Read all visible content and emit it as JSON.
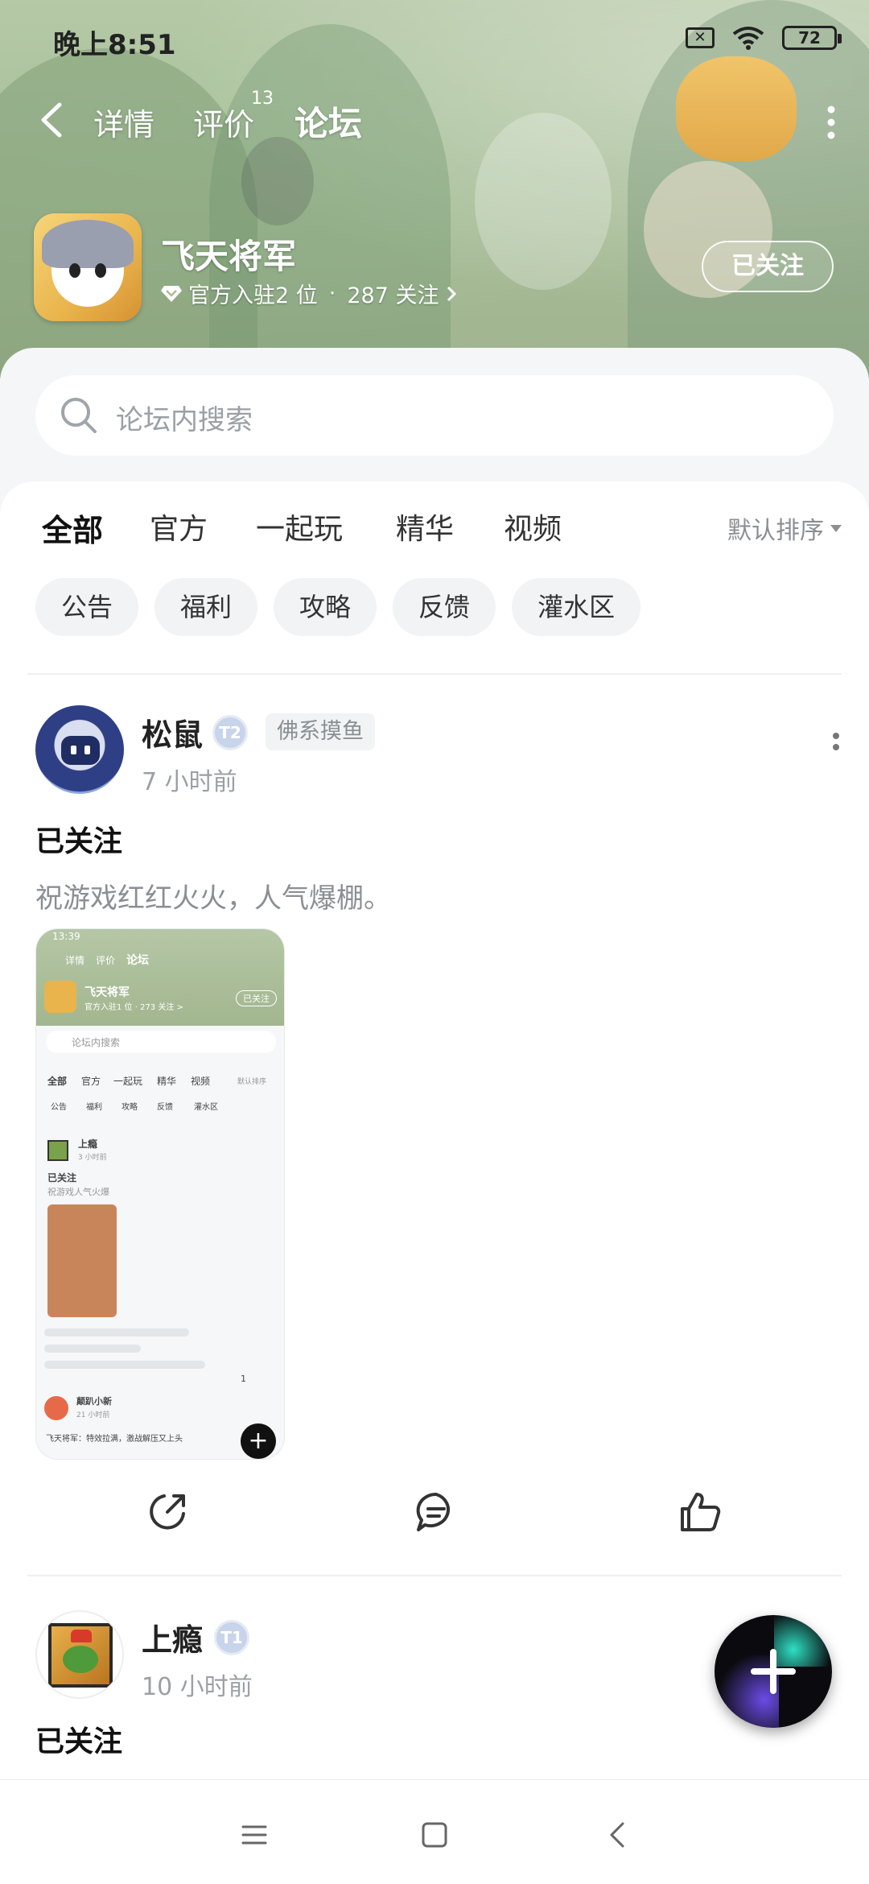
{
  "status_bar": {
    "time": "晚上8:51",
    "battery": "72"
  },
  "nav": {
    "tabs": [
      {
        "label": "详情"
      },
      {
        "label": "评价"
      },
      {
        "label": "论坛"
      }
    ],
    "review_count": "13",
    "active_tab": "论坛"
  },
  "game": {
    "title": "飞天将军",
    "official_text": "官方入驻2 位",
    "separator": "·",
    "followers_text": "287 关注",
    "follow_button": "已关注"
  },
  "search": {
    "placeholder": "论坛内搜索"
  },
  "categories": {
    "tabs": [
      "全部",
      "官方",
      "一起玩",
      "精华",
      "视频"
    ],
    "active": "全部",
    "sort_label": "默认排序"
  },
  "chips": [
    "公告",
    "福利",
    "攻略",
    "反馈",
    "灌水区"
  ],
  "posts": [
    {
      "user": "松鼠",
      "user_tag": "佛系摸鱼",
      "time": "7 小时前",
      "title": "已关注",
      "body": "祝游戏红红火火，人气爆棚。",
      "screenshot": {
        "time": "13:39",
        "tabs": [
          "详情",
          "评价",
          "论坛"
        ],
        "game_title": "飞天将军",
        "game_sub": "官方入驻1 位 · 273 关注 >",
        "follow": "已关注",
        "search": "论坛内搜索",
        "cats": [
          "全部",
          "官方",
          "一起玩",
          "精华",
          "视频"
        ],
        "sort": "默认排序",
        "chips": [
          "公告",
          "福利",
          "攻略",
          "反馈",
          "灌水区"
        ],
        "post1_user": "上瘾",
        "post1_time": "3 小时前",
        "post1_title": "已关注",
        "post1_body": "祝游戏人气火爆",
        "post2_user": "颠趴小新",
        "post2_time": "21 小时前",
        "post2_body": "飞天将军：特效拉满，激战解压又上头",
        "like_count": "1"
      }
    },
    {
      "user": "上瘾",
      "time": "10 小时前",
      "title": "已关注"
    }
  ],
  "colors": {
    "accent": "#19d3b8",
    "banner": "#a9bd98"
  },
  "icons": [
    "back-icon",
    "more-icon",
    "search-icon",
    "share-icon",
    "comment-icon",
    "like-icon",
    "plus-icon",
    "menu-icon",
    "home-icon",
    "back-nav-icon"
  ]
}
